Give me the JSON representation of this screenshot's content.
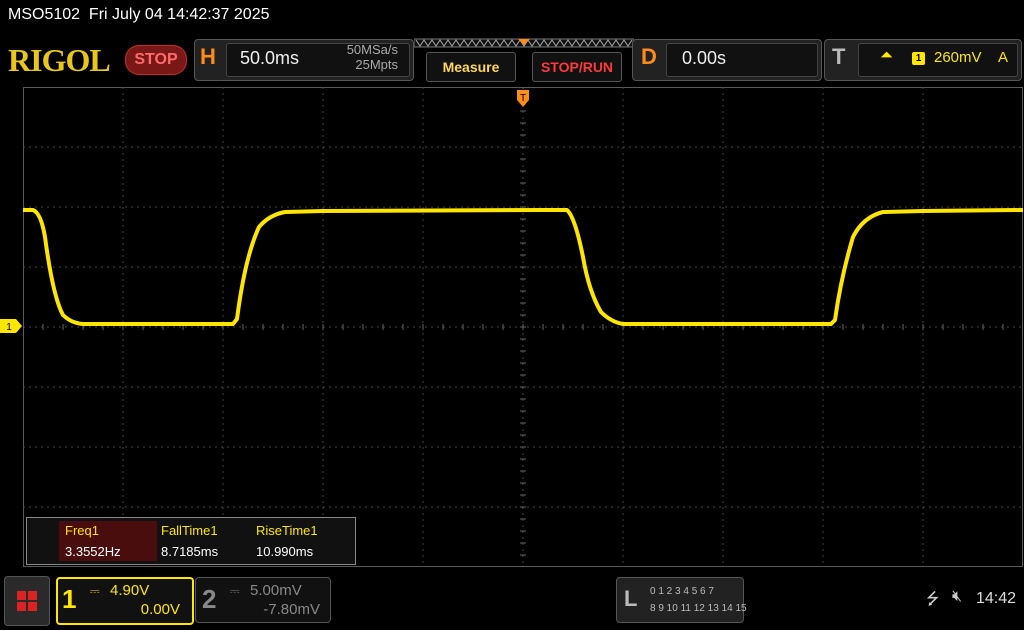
{
  "title_bar": {
    "text": "MSO5102  Fri July 04 14:42:37 2025"
  },
  "brand": {
    "logo": "RIGOL",
    "run_state": "STOP"
  },
  "horizontal": {
    "letter": "H",
    "timebase": "50.0ms",
    "sample_rate": "50MSa/s",
    "memory_depth": "25Mpts"
  },
  "buttons": {
    "measure": "Measure",
    "stop_run": "STOP/RUN"
  },
  "delay": {
    "letter": "D",
    "value": "0.00s"
  },
  "trigger": {
    "letter": "T",
    "edge_icon": "rising-edge-icon",
    "source": "1",
    "level": "260mV",
    "mode": "A"
  },
  "markers": {
    "trigger_position": "T",
    "channel1_ground": "1"
  },
  "measurements": {
    "headers": [
      "Freq1",
      "FallTime1",
      "RiseTime1"
    ],
    "values": [
      "3.3552Hz",
      "8.7185ms",
      "10.990ms"
    ]
  },
  "channels": [
    {
      "num": "1",
      "scale": "4.90V",
      "offset": "0.00V",
      "coupling_icon": "dc-coupling-icon"
    },
    {
      "num": "2",
      "scale": "5.00mV",
      "offset": "-7.80mV",
      "coupling_icon": "dc-coupling-icon"
    }
  ],
  "logic": {
    "letter": "L",
    "row1": "0 1 2 3  4 5 6 7",
    "row2": "8 9 10 11 12 13 14 15"
  },
  "status": {
    "clock": "14:42",
    "usb_icon": "usb-icon",
    "sound_icon": "mute-icon"
  },
  "colors": {
    "ch1": "#ffe600",
    "accent": "#ff8c1a",
    "stop": "#ff3a3a",
    "grid": "#5a5a5a"
  }
}
